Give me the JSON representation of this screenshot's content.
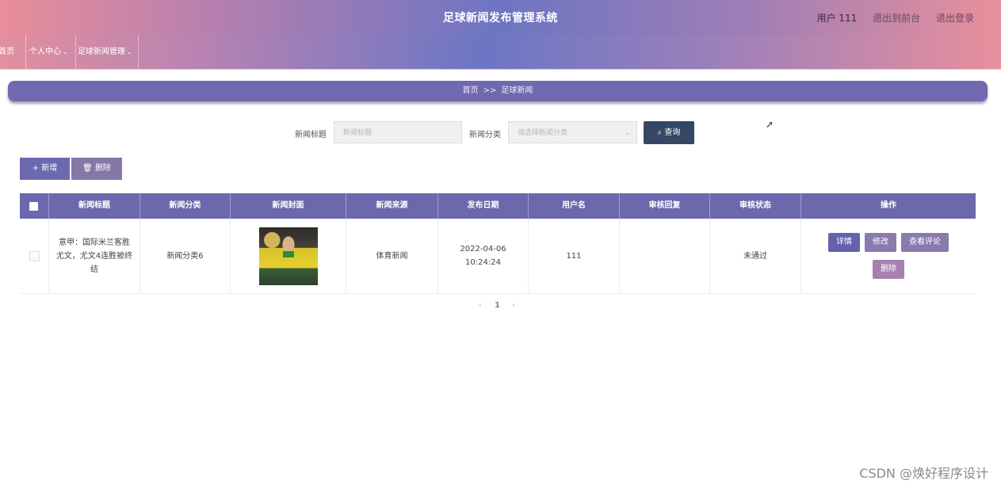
{
  "header": {
    "title": "足球新闻发布管理系统",
    "user_label": "用户 111",
    "exit_front": "退出到前台",
    "logout": "退出登录"
  },
  "nav": {
    "items": [
      {
        "label": "首页",
        "has_dropdown": false
      },
      {
        "label": "个人中心",
        "has_dropdown": true
      },
      {
        "label": "足球新闻管理",
        "has_dropdown": true
      }
    ],
    "chevron": "⌄"
  },
  "breadcrumb": {
    "home": "首页",
    "separator": ">>",
    "current": "足球新闻"
  },
  "search": {
    "title_label": "新闻标题",
    "title_placeholder": "新闻标题",
    "category_label": "新闻分类",
    "category_placeholder": "请选择新闻分类",
    "query_icon": "search-icon",
    "query_label": "查询"
  },
  "actions": {
    "add_icon": "plus-icon",
    "add_label": "新增",
    "delete_icon": "trash-icon",
    "delete_label": "删除"
  },
  "table": {
    "columns": [
      "新闻标题",
      "新闻分类",
      "新闻封面",
      "新闻来源",
      "发布日期",
      "用户名",
      "审核回复",
      "审核状态",
      "操作"
    ],
    "rows": [
      {
        "title": "意甲：国际米兰客胜尤文，尤文4连胜被终结",
        "category": "新闻分类6",
        "cover": "football-player-with-trophy",
        "source": "体育新闻",
        "date": "2022-04-06 10:24:24",
        "username": "111",
        "review_reply": "",
        "review_status": "未通过",
        "ops": {
          "detail": "详情",
          "edit": "修改",
          "comments": "查看评论",
          "delete": "删除"
        }
      }
    ]
  },
  "pagination": {
    "prev": "‹",
    "current": "1",
    "next": "›"
  },
  "watermark": "CSDN @焕好程序设计",
  "colors": {
    "header_gradient": [
      "#e98e9a",
      "#6d75c2",
      "#e9909b"
    ],
    "primary": "#6b68ad",
    "query_button": "#344764",
    "pager_active": "#5d9b74"
  }
}
